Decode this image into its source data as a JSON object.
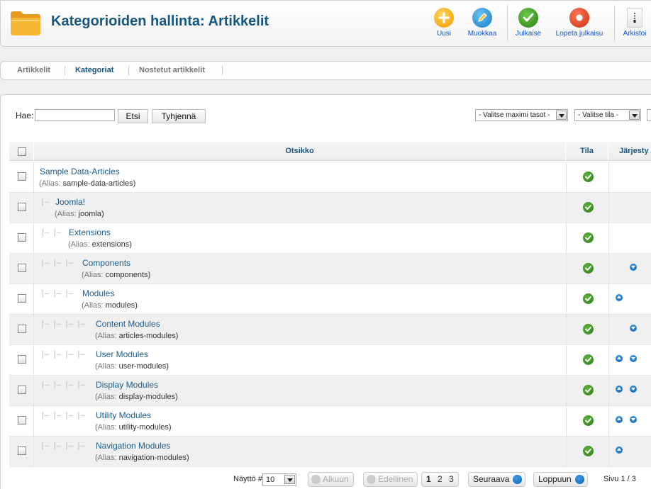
{
  "header": {
    "title": "Kategorioiden hallinta: Artikkelit",
    "buttons": [
      {
        "label": "Uusi",
        "icon": "plus-icon",
        "color": "#f5a800"
      },
      {
        "label": "Muokkaa",
        "icon": "pencil-icon",
        "color": "#1f8fd6"
      },
      {
        "label": "Julkaise",
        "icon": "check-icon",
        "color": "#3d9a1e"
      },
      {
        "label": "Lopeta julkaisu",
        "icon": "stop-icon",
        "color": "#e03a1e"
      },
      {
        "label": "Arkistoi",
        "icon": "archive-icon",
        "color": "#999999"
      }
    ]
  },
  "submenu": {
    "items": [
      {
        "label": "Artikkelit"
      },
      {
        "label": "Kategoriat"
      },
      {
        "label": "Nostetut artikkelit"
      }
    ]
  },
  "filter": {
    "search_label": "Hae:",
    "search_value": "",
    "search_button": "Etsi",
    "clear_button": "Tyhjennä",
    "max_levels": "- Valitse maximi tasot -",
    "state": "- Valitse tila -"
  },
  "table": {
    "headers": {
      "title": "Otsikko",
      "status": "Tila",
      "ordering": "Järjesty"
    },
    "alias_label": "(Alias:",
    "rows": [
      {
        "title": "Sample Data-Articles",
        "alias": "sample-data-articles)",
        "level": 0,
        "up": false,
        "down": false
      },
      {
        "title": "Joomla!",
        "alias": "joomla)",
        "level": 1,
        "up": false,
        "down": false
      },
      {
        "title": "Extensions",
        "alias": "extensions)",
        "level": 2,
        "up": false,
        "down": false
      },
      {
        "title": "Components",
        "alias": "components)",
        "level": 3,
        "up": false,
        "down": true
      },
      {
        "title": "Modules",
        "alias": "modules)",
        "level": 3,
        "up": true,
        "down": false
      },
      {
        "title": "Content Modules",
        "alias": "articles-modules)",
        "level": 4,
        "up": false,
        "down": true
      },
      {
        "title": "User Modules",
        "alias": "user-modules)",
        "level": 4,
        "up": true,
        "down": true
      },
      {
        "title": "Display Modules",
        "alias": "display-modules)",
        "level": 4,
        "up": true,
        "down": true
      },
      {
        "title": "Utility Modules",
        "alias": "utility-modules)",
        "level": 4,
        "up": true,
        "down": true
      },
      {
        "title": "Navigation Modules",
        "alias": "navigation-modules)",
        "level": 4,
        "up": true,
        "down": false
      }
    ]
  },
  "pagination": {
    "display_label": "Näyttö #",
    "display_value": "10",
    "start": "Alkuun",
    "prev": "Edellinen",
    "pages": [
      "1",
      "2",
      "3"
    ],
    "next": "Seuraava",
    "end": "Loppuun",
    "page_info": "Sivu 1 / 3"
  },
  "colors": {
    "title": "#15577e",
    "link": "#1b5d8d",
    "published": "#3d9a1e"
  }
}
